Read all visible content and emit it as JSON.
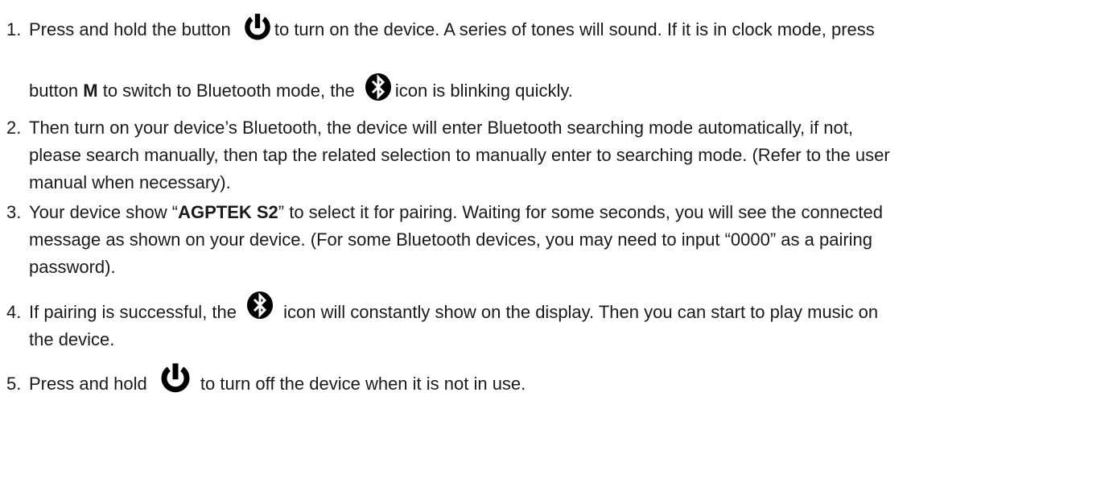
{
  "steps": [
    {
      "number": "1.",
      "line1_before": "Press and hold the button",
      "line1_after": "to turn on the device. A series of tones will sound. If it is in clock mode, press",
      "line2_a": "button ",
      "line2_bold": "M",
      "line2_b": " to switch to Bluetooth mode, the",
      "line2_after": "icon is blinking quickly."
    },
    {
      "number": "2.",
      "line1": "Then turn on your device’s Bluetooth, the device will enter Bluetooth searching mode automatically, if not,",
      "line2": "please search manually, then tap the related selection to manually enter to searching mode. (Refer to the user",
      "line3": "manual when necessary)."
    },
    {
      "number": "3.",
      "line1_a": "Your device show “",
      "line1_bold": "AGPTEK S2",
      "line1_b": "” to select it for pairing. Waiting for some seconds, you will see the connected",
      "line2": "message as shown on your device. (For some Bluetooth devices, you may need to input “0000” as a pairing",
      "line3": "password)."
    },
    {
      "number": "4.",
      "line1_before": "If pairing is successful, the",
      "line1_after": "icon will constantly show on the display. Then you can start to play music on",
      "line2": "the device."
    },
    {
      "number": "5.",
      "line1_before": "Press and hold",
      "line1_after": "to turn off the device when it is not in use."
    }
  ]
}
